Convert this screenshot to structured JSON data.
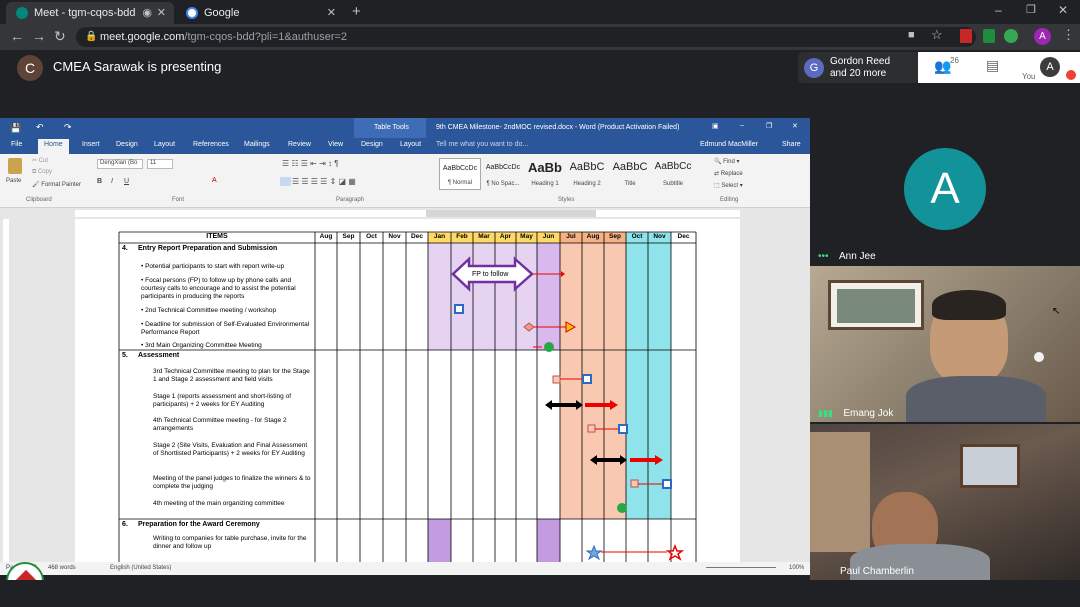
{
  "browser": {
    "tabs": [
      {
        "title": "Meet - tgm-cqos-bdd",
        "active": true
      },
      {
        "title": "Google",
        "active": false
      }
    ],
    "new_tab": "+",
    "url_host": "meet.google.com",
    "url_path": "/tgm-cqos-bdd?pli=1&authuser=2",
    "profile_initial": "A"
  },
  "meet": {
    "presenter_initial": "C",
    "presenting_text": "CMEA Sarawak is presenting",
    "people_initial": "G",
    "people_line1": "Gordon Reed",
    "people_line2": "and 20 more",
    "participant_count": "26",
    "you_label": "You",
    "you_initial": "A",
    "participants": [
      {
        "name": "Ann Jee",
        "initial": "A"
      },
      {
        "name": "Emang Jok"
      },
      {
        "name": "Paul Chamberlin"
      }
    ]
  },
  "word": {
    "title": "9th CMEA Milestone- 2ndMOC revised.docx - Word (Product Activation Failed)",
    "table_tools": "Table Tools",
    "user": "Edmund MacMiller",
    "share": "Share",
    "tell_me": "Tell me what you want to do...",
    "tabs": [
      "File",
      "Home",
      "Insert",
      "Design",
      "Layout",
      "References",
      "Mailings",
      "Review",
      "View",
      "Design",
      "Layout"
    ],
    "clipboard": {
      "paste": "Paste",
      "cut": "Cut",
      "copy": "Copy",
      "format_painter": "Format Painter",
      "label": "Clipboard"
    },
    "font": {
      "name": "DengXian (Bo",
      "size": "11",
      "label": "Font"
    },
    "paragraph_label": "Paragraph",
    "styles": [
      {
        "preview": "AaBbCcDc",
        "name": "¶ Normal"
      },
      {
        "preview": "AaBbCcDc",
        "name": "¶ No Spac..."
      },
      {
        "preview": "AaBb",
        "name": "Heading 1"
      },
      {
        "preview": "AaBbC",
        "name": "Heading 2"
      },
      {
        "preview": "AaBbC",
        "name": "Title"
      },
      {
        "preview": "AaBbCc",
        "name": "Subtitle"
      }
    ],
    "styles_label": "Styles",
    "editing": {
      "find": "Find",
      "replace": "Replace",
      "select": "Select",
      "label": "Editing"
    },
    "status": {
      "page": "Page 2 of 3",
      "words": "468 words",
      "language": "English (United States)",
      "zoom": "100%"
    }
  },
  "gantt": {
    "items_header": "ITEMS",
    "months": [
      "Aug",
      "Sep",
      "Oct",
      "Nov",
      "Dec",
      "Jan",
      "Feb",
      "Mar",
      "Apr",
      "May",
      "Jun",
      "Jul",
      "Aug",
      "Sep",
      "Oct",
      "Nov",
      "Dec"
    ],
    "month_colors": [
      "#ffffff",
      "#ffffff",
      "#ffffff",
      "#ffffff",
      "#ffffff",
      "#ffd966",
      "#ffd966",
      "#ffd966",
      "#ffd966",
      "#ffd966",
      "#ffd966",
      "#f4b183",
      "#f4b183",
      "#f4b183",
      "#8fe3ea",
      "#8fe3ea",
      "#ffffff"
    ],
    "sections": [
      {
        "num": "4.",
        "title": "Entry Report Preparation and Submission",
        "tasks": [
          "Potential participants to start with report write-up",
          "Focal persons (FP) to follow up by phone calls and courtesy calls to encourage and to assist the potential participants in producing the reports",
          "2nd Technical Committee meeting / workshop",
          "Deadline for submission of Self-Evaluated Environmental Performance Report",
          "3rd Main Organizing Committee Meeting"
        ],
        "arrow_label": "FP to follow"
      },
      {
        "num": "5.",
        "title": "Assessment",
        "tasks": [
          "3rd Technical Committee meeting to plan for the Stage 1 and Stage 2 assessment and field visits",
          "Stage 1 (reports assessment and short-listing of participants) + 2 weeks for EY Auditing",
          "4th Technical Committee meeting - for Stage 2 arrangements",
          "Stage 2 (Site Visits, Evaluation and Final Assessment of Shortlisted Participants) + 2 weeks for EY Auditing",
          "Meeting of the panel judges to finalize the winners & to complete the judging",
          "4th meeting of the main organizing committee"
        ]
      },
      {
        "num": "6.",
        "title": "Preparation for the Award Ceremony",
        "tasks": [
          "Writing to companies for table purchase, invite for the dinner and follow up"
        ]
      }
    ]
  },
  "colors": {
    "word_blue": "#2b579a",
    "meet_bg": "#202124",
    "avatar_teal": "#12939a",
    "section_purple": "#e6d3f2",
    "jul_sep_orange": "#f8c9b0",
    "oct_nov_cyan": "#8fe3ea"
  }
}
